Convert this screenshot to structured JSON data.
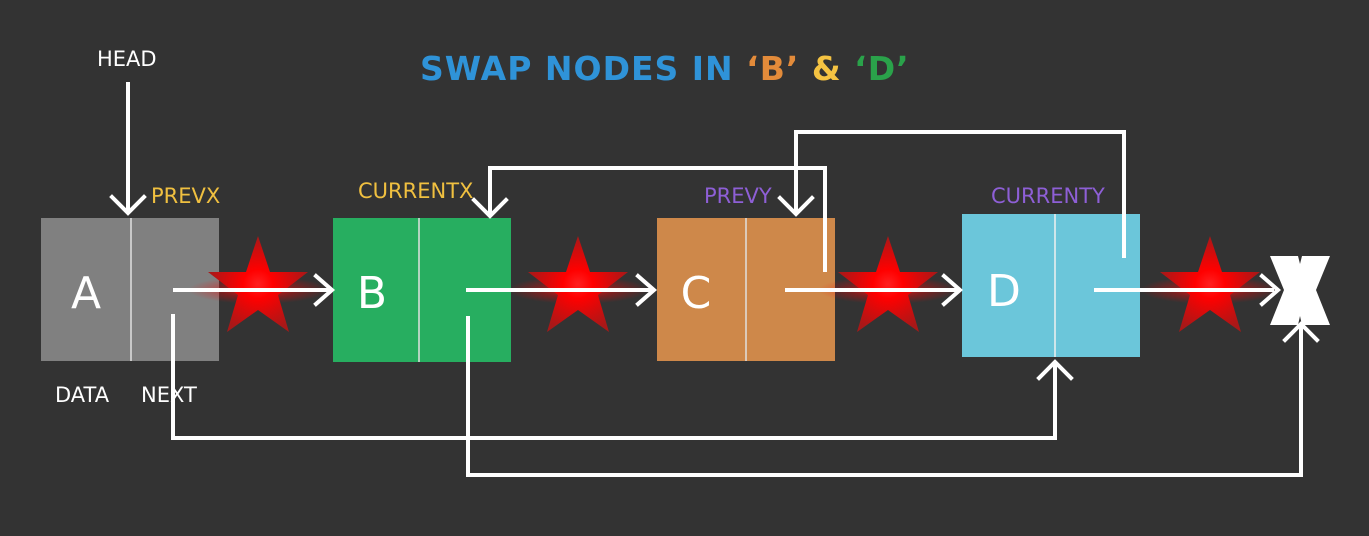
{
  "title": {
    "prefix": "SWAP NODES IN ",
    "open_quote_1": "‘",
    "b": "B",
    "close_quote_1": "’",
    "amp": " & ",
    "open_quote_2": "‘",
    "d": "D",
    "close_quote_2": "’"
  },
  "labels": {
    "head": "HEAD",
    "prevx": "PREVX",
    "currentx": "CURRENTX",
    "prevy": "PREVY",
    "currenty": "CURRENTY",
    "data": "DATA",
    "next": "NEXT"
  },
  "nodes": [
    {
      "letter": "A",
      "color": "#808080"
    },
    {
      "letter": "B",
      "color": "#27ae60"
    },
    {
      "letter": "C",
      "color": "#ce884a"
    },
    {
      "letter": "D",
      "color": "#6bc6da"
    }
  ],
  "end_marker": "X",
  "colors": {
    "background": "#333333",
    "title_blue": "#2f93d8",
    "orange": "#e38b3a",
    "yellow": "#f5c342",
    "green": "#2aa24a",
    "label_yellow": "#f0c040",
    "label_purple": "#8e5fd6",
    "label_white": "#ffffff",
    "star_red": "#ff1010",
    "arrow": "#ffffff"
  },
  "icons": {
    "broken_link": "red-star-icon",
    "terminator": "x-mark-icon"
  }
}
